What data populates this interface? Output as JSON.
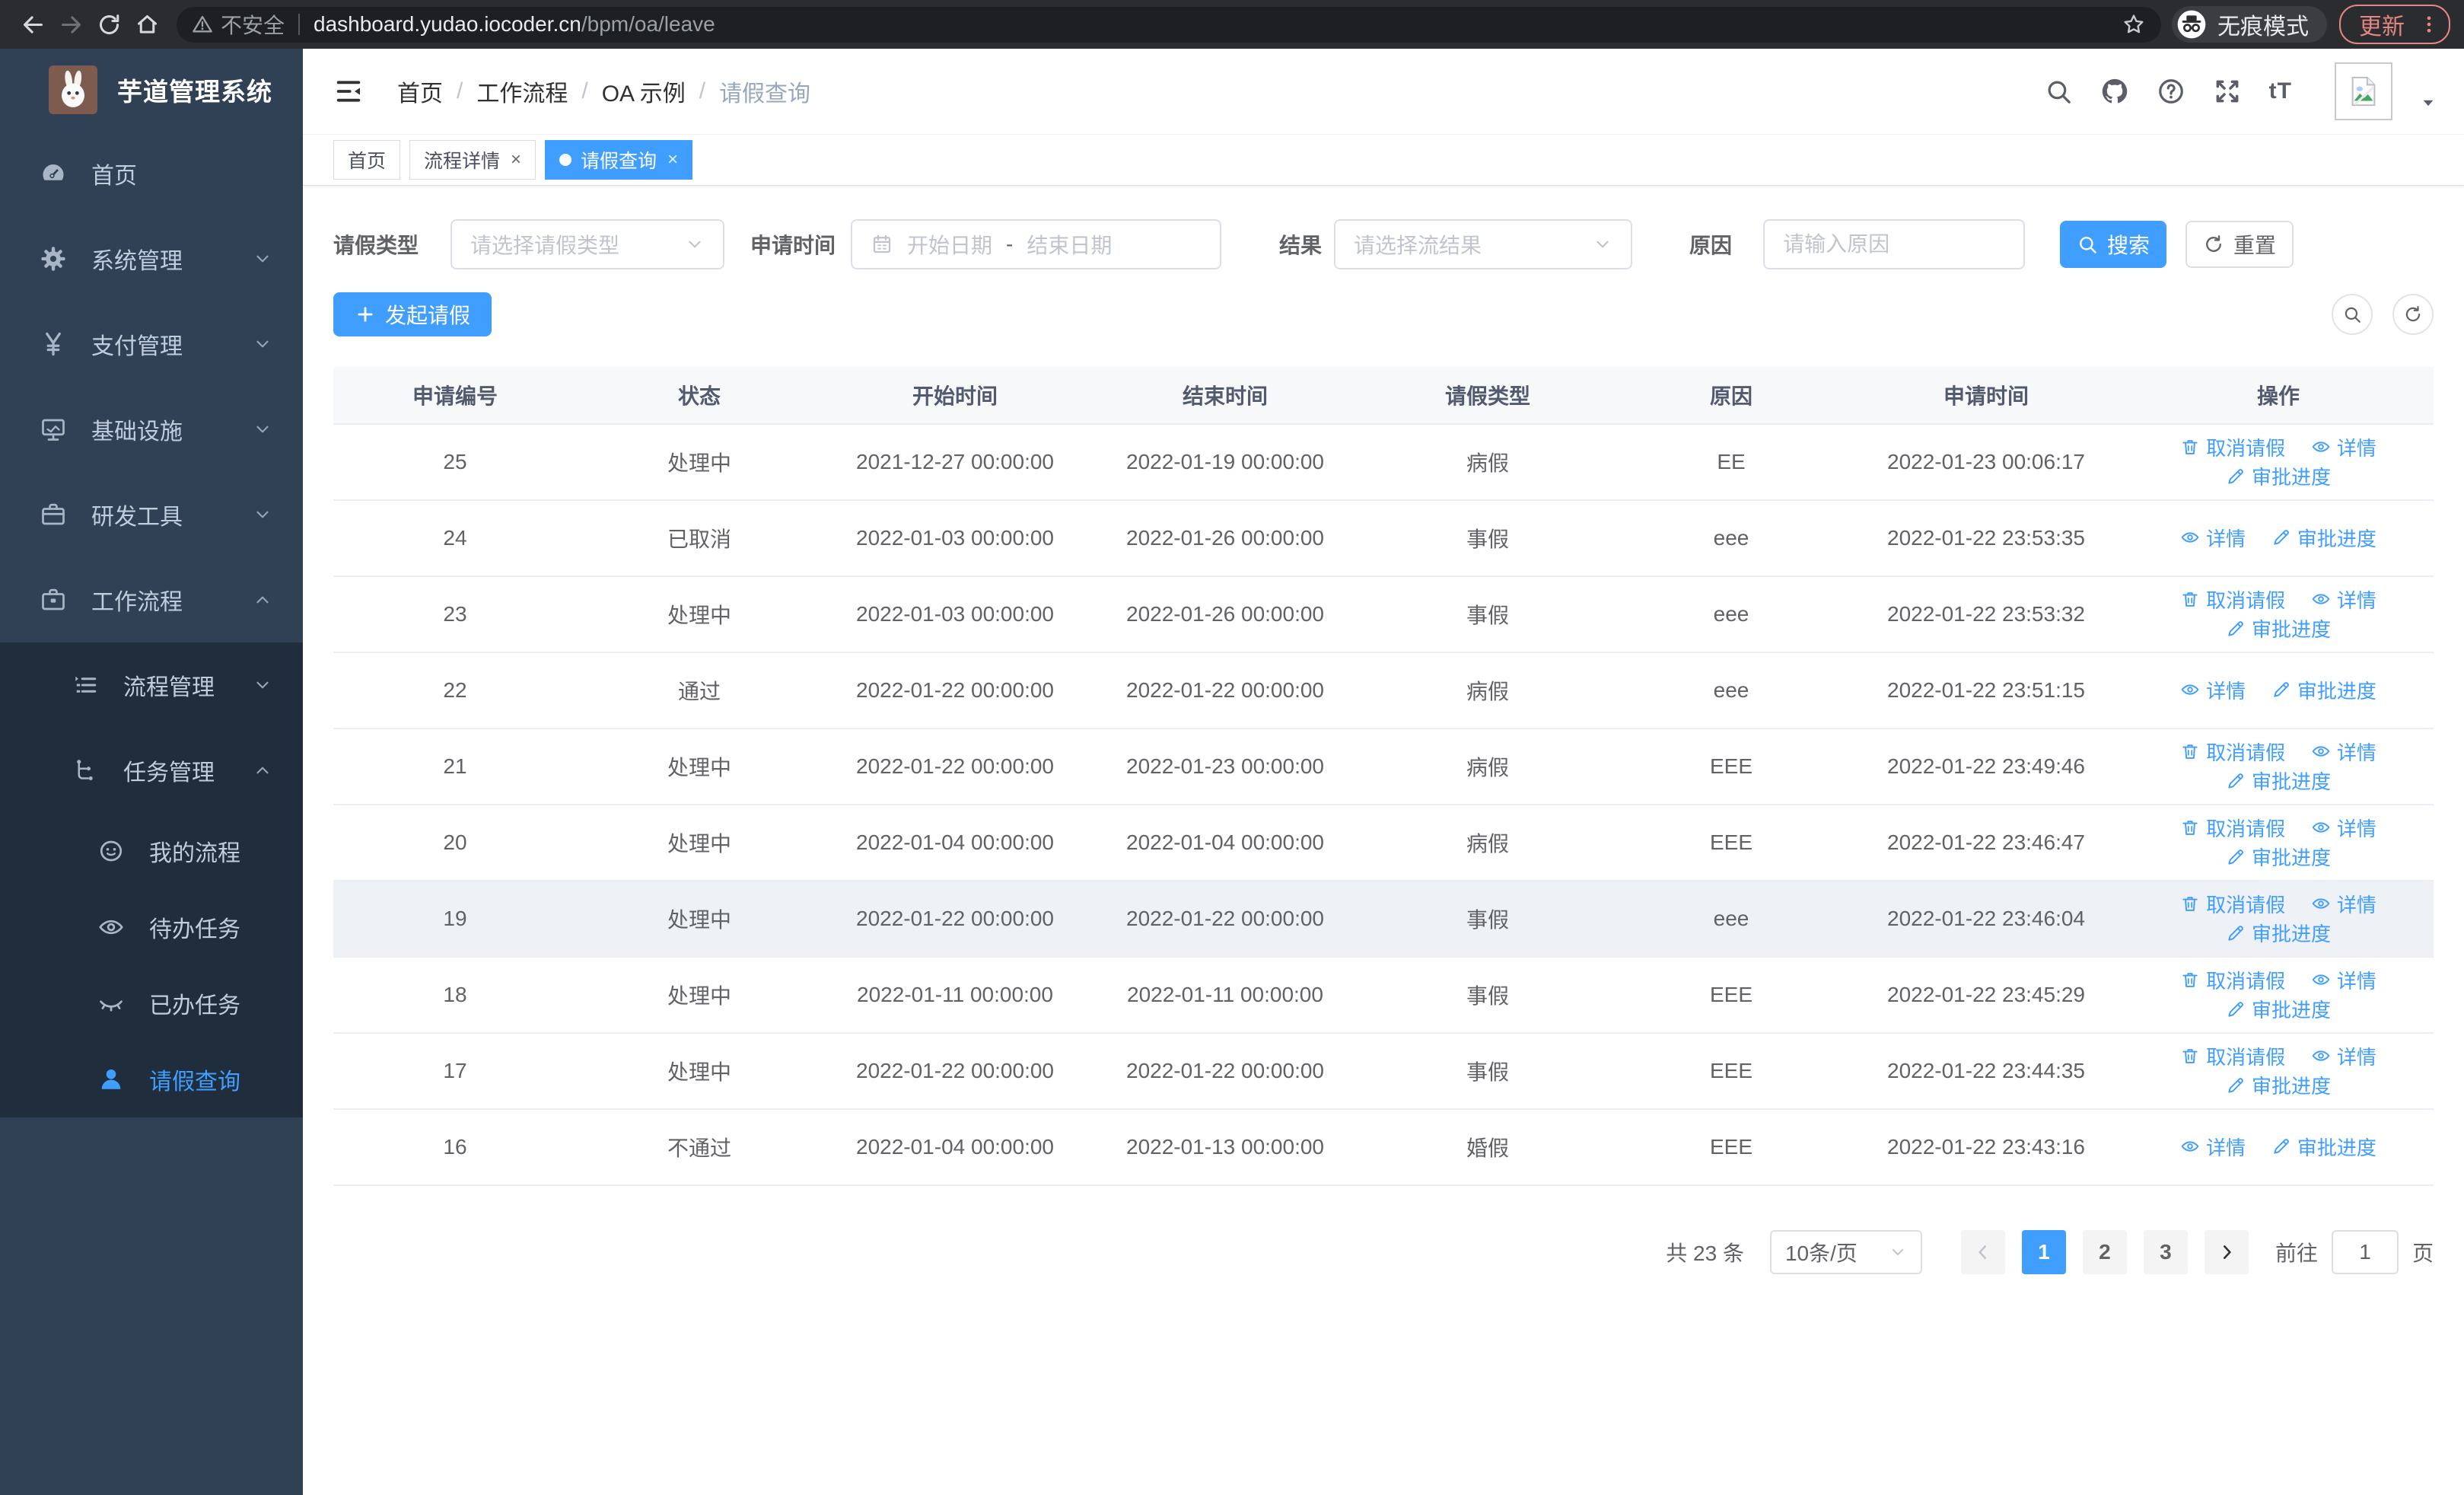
{
  "browser": {
    "security_label": "不安全",
    "url_host": "dashboard.yudao.iocoder.cn",
    "url_path": "/bpm/oa/leave",
    "incognito_label": "无痕模式",
    "update_label": "更新"
  },
  "sidebar": {
    "app_title": "芋道管理系统",
    "menu": [
      {
        "key": "home",
        "label": "首页",
        "icon": "dashboard-icon",
        "type": "item",
        "level": 1,
        "submenu": false,
        "active": false
      },
      {
        "key": "system-management",
        "label": "系统管理",
        "icon": "gear-icon",
        "type": "group",
        "level": 1,
        "submenu": false,
        "expanded": false
      },
      {
        "key": "payment-management",
        "label": "支付管理",
        "icon": "yen-icon",
        "type": "group",
        "level": 1,
        "submenu": false,
        "expanded": false
      },
      {
        "key": "infrastructure",
        "label": "基础设施",
        "icon": "monitor-icon",
        "type": "group",
        "level": 1,
        "submenu": false,
        "expanded": false
      },
      {
        "key": "dev-tools",
        "label": "研发工具",
        "icon": "briefcase-icon",
        "type": "group",
        "level": 1,
        "submenu": false,
        "expanded": false
      },
      {
        "key": "workflow",
        "label": "工作流程",
        "icon": "workflow-icon",
        "type": "group",
        "level": 1,
        "submenu": false,
        "expanded": true
      },
      {
        "key": "process-management",
        "label": "流程管理",
        "icon": "list-icon",
        "type": "group",
        "level": 2,
        "submenu": true,
        "expanded": false
      },
      {
        "key": "task-management",
        "label": "任务管理",
        "icon": "tree-icon",
        "type": "group",
        "level": 2,
        "submenu": true,
        "expanded": true
      },
      {
        "key": "my-process",
        "label": "我的流程",
        "icon": "face-icon",
        "type": "item",
        "level": 3,
        "submenu": true,
        "active": false
      },
      {
        "key": "todo-tasks",
        "label": "待办任务",
        "icon": "eye-icon",
        "type": "item",
        "level": 3,
        "submenu": true,
        "active": false
      },
      {
        "key": "done-tasks",
        "label": "已办任务",
        "icon": "eye-closed-icon",
        "type": "item",
        "level": 3,
        "submenu": true,
        "active": false
      },
      {
        "key": "leave-query",
        "label": "请假查询",
        "icon": "user-icon",
        "type": "item",
        "level": 3,
        "submenu": true,
        "active": true
      }
    ]
  },
  "header": {
    "breadcrumb": [
      "首页",
      "工作流程",
      "OA 示例",
      "请假查询"
    ]
  },
  "tabs": [
    {
      "key": "home",
      "label": "首页",
      "closable": false,
      "active": false
    },
    {
      "key": "process-detail",
      "label": "流程详情",
      "closable": true,
      "active": false
    },
    {
      "key": "leave-query",
      "label": "请假查询",
      "closable": true,
      "active": true
    }
  ],
  "filters": {
    "leave_type_label": "请假类型",
    "leave_type_placeholder": "请选择请假类型",
    "apply_time_label": "申请时间",
    "date_start_placeholder": "开始日期",
    "date_separator": "-",
    "date_end_placeholder": "结束日期",
    "result_label": "结果",
    "result_placeholder": "请选择流结果",
    "reason_label": "原因",
    "reason_placeholder": "请输入原因",
    "search_label": "搜索",
    "reset_label": "重置"
  },
  "toolbar": {
    "create_label": "发起请假"
  },
  "table": {
    "columns": [
      "申请编号",
      "状态",
      "开始时间",
      "结束时间",
      "请假类型",
      "原因",
      "申请时间",
      "操作"
    ],
    "action_labels": {
      "cancel": "取消请假",
      "detail": "详情",
      "progress": "审批进度"
    },
    "rows": [
      {
        "id": "25",
        "status": "处理中",
        "start": "2021-12-27 00:00:00",
        "end": "2022-01-19 00:00:00",
        "type": "病假",
        "reason": "EE",
        "applied": "2022-01-23 00:06:17",
        "actions": [
          "cancel",
          "detail",
          "progress"
        ],
        "hover": false
      },
      {
        "id": "24",
        "status": "已取消",
        "start": "2022-01-03 00:00:00",
        "end": "2022-01-26 00:00:00",
        "type": "事假",
        "reason": "eee",
        "applied": "2022-01-22 23:53:35",
        "actions": [
          "detail",
          "progress"
        ],
        "hover": false
      },
      {
        "id": "23",
        "status": "处理中",
        "start": "2022-01-03 00:00:00",
        "end": "2022-01-26 00:00:00",
        "type": "事假",
        "reason": "eee",
        "applied": "2022-01-22 23:53:32",
        "actions": [
          "cancel",
          "detail",
          "progress"
        ],
        "hover": false
      },
      {
        "id": "22",
        "status": "通过",
        "start": "2022-01-22 00:00:00",
        "end": "2022-01-22 00:00:00",
        "type": "病假",
        "reason": "eee",
        "applied": "2022-01-22 23:51:15",
        "actions": [
          "detail",
          "progress"
        ],
        "hover": false
      },
      {
        "id": "21",
        "status": "处理中",
        "start": "2022-01-22 00:00:00",
        "end": "2022-01-23 00:00:00",
        "type": "病假",
        "reason": "EEE",
        "applied": "2022-01-22 23:49:46",
        "actions": [
          "cancel",
          "detail",
          "progress"
        ],
        "hover": false
      },
      {
        "id": "20",
        "status": "处理中",
        "start": "2022-01-04 00:00:00",
        "end": "2022-01-04 00:00:00",
        "type": "病假",
        "reason": "EEE",
        "applied": "2022-01-22 23:46:47",
        "actions": [
          "cancel",
          "detail",
          "progress"
        ],
        "hover": false
      },
      {
        "id": "19",
        "status": "处理中",
        "start": "2022-01-22 00:00:00",
        "end": "2022-01-22 00:00:00",
        "type": "事假",
        "reason": "eee",
        "applied": "2022-01-22 23:46:04",
        "actions": [
          "cancel",
          "detail",
          "progress"
        ],
        "hover": true
      },
      {
        "id": "18",
        "status": "处理中",
        "start": "2022-01-11 00:00:00",
        "end": "2022-01-11 00:00:00",
        "type": "事假",
        "reason": "EEE",
        "applied": "2022-01-22 23:45:29",
        "actions": [
          "cancel",
          "detail",
          "progress"
        ],
        "hover": false
      },
      {
        "id": "17",
        "status": "处理中",
        "start": "2022-01-22 00:00:00",
        "end": "2022-01-22 00:00:00",
        "type": "事假",
        "reason": "EEE",
        "applied": "2022-01-22 23:44:35",
        "actions": [
          "cancel",
          "detail",
          "progress"
        ],
        "hover": false
      },
      {
        "id": "16",
        "status": "不通过",
        "start": "2022-01-04 00:00:00",
        "end": "2022-01-13 00:00:00",
        "type": "婚假",
        "reason": "EEE",
        "applied": "2022-01-22 23:43:16",
        "actions": [
          "detail",
          "progress"
        ],
        "hover": false
      }
    ]
  },
  "pagination": {
    "total_label": "共 23 条",
    "page_size": "10条/页",
    "pages": [
      "1",
      "2",
      "3"
    ],
    "active_page": "1",
    "goto_label": "前往",
    "goto_value": "1",
    "page_suffix": "页"
  },
  "colors": {
    "accent": "#409eff",
    "sidebar_bg": "#304156",
    "sidebar_submenu_bg": "#1f2d3d",
    "update_color": "#e38784"
  }
}
